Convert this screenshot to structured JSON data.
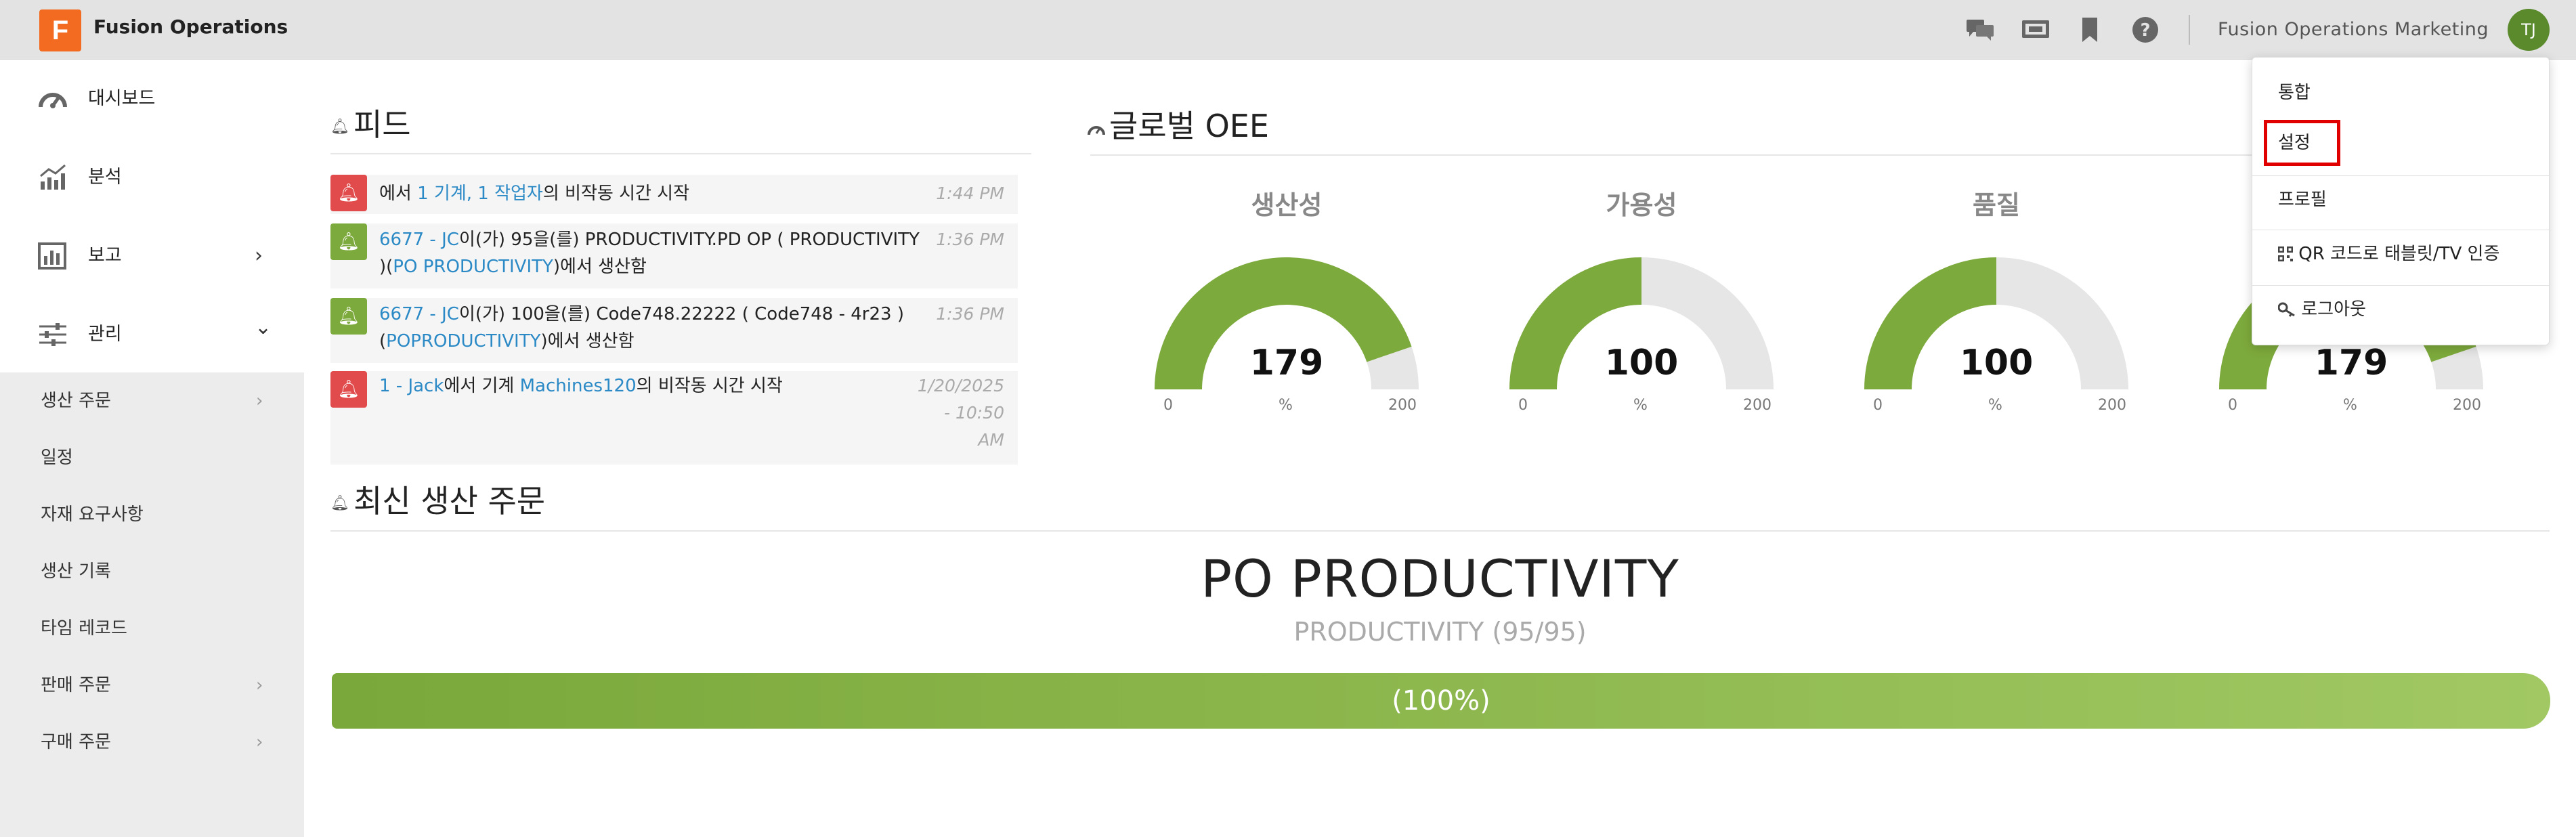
{
  "app": {
    "logo_letter": "F",
    "name": "Fusion Operations"
  },
  "header": {
    "icons": [
      "chat-icon",
      "monitor-icon",
      "bookmark-icon",
      "help-icon"
    ],
    "organization": "Fusion Operations Marketing",
    "user_initials": "TJ"
  },
  "sidebar": {
    "main_items": [
      {
        "label": "대시보드",
        "icon": "dashboard-icon"
      },
      {
        "label": "분석",
        "icon": "analytics-icon"
      },
      {
        "label": "보고",
        "icon": "report-icon",
        "chevron": "›"
      },
      {
        "label": "관리",
        "icon": "sliders-icon",
        "chevron": "⌄"
      }
    ],
    "sub_items": [
      {
        "label": "생산 주문",
        "chevron": "›"
      },
      {
        "label": "일정"
      },
      {
        "label": "자재 요구사항"
      },
      {
        "label": "생산 기록"
      },
      {
        "label": "타임 레코드"
      },
      {
        "label": "판매 주문",
        "chevron": "›"
      },
      {
        "label": "구매 주문",
        "chevron": "›"
      }
    ]
  },
  "feed": {
    "title": "피드",
    "items": [
      {
        "status": "red",
        "line1": {
          "pre": "에서 ",
          "link": "1 기계, 1 작업자",
          "post": "의 비작동 시간 시작"
        },
        "time": "1:44 PM"
      },
      {
        "status": "green",
        "line1": {
          "link": "6677 - JC",
          "post": "이(가) 95을(를) PRODUCTIVITY.PD OP ( PRODUCTIVITY"
        },
        "line2": {
          "pre": ")(",
          "link": "PO PRODUCTIVITY",
          "post": ")에서 생산함"
        },
        "time": "1:36 PM"
      },
      {
        "status": "green",
        "line1": {
          "link": "6677 - JC",
          "post": "이(가) 100을(를) Code748.22222 ( Code748 - 4r23 )"
        },
        "line2": {
          "pre": "(",
          "link": "POPRODUCTIVITY",
          "post": ")에서 생산함"
        },
        "time": "1:36 PM"
      },
      {
        "status": "red",
        "line1": {
          "link": "1 - Jack",
          "mid": "에서 기계 ",
          "link2": "Machines120",
          "post": "의 비작동 시간 시작"
        },
        "time_lines": [
          "1/20/2025",
          "- 10:50",
          "AM"
        ]
      }
    ]
  },
  "oee": {
    "title": "글로벌 OEE",
    "gauges": [
      {
        "label": "생산성",
        "value": 179,
        "display": "179",
        "min": "0",
        "max": "200",
        "unit": "%"
      },
      {
        "label": "가용성",
        "value": 100,
        "display": "100",
        "min": "0",
        "max": "200",
        "unit": "%"
      },
      {
        "label": "품질",
        "value": 100,
        "display": "100",
        "min": "0",
        "max": "200",
        "unit": "%"
      },
      {
        "label": "",
        "value": 179,
        "display": "179",
        "min": "0",
        "max": "200",
        "unit": "%"
      }
    ],
    "colors": {
      "fill": "#7daa3c",
      "track": "#e6e6e6"
    }
  },
  "latest_orders": {
    "title": "최신 생산 주문",
    "order_name": "PO PRODUCTIVITY",
    "order_detail": "PRODUCTIVITY (95/95)",
    "progress": 1.0,
    "progress_label": "(100%)"
  },
  "user_menu": {
    "items": [
      {
        "label": "통합"
      },
      {
        "label": "설정",
        "highlighted": true
      },
      {
        "label": "프로필"
      },
      {
        "label": "QR 코드로 태블릿/TV 인증",
        "icon": "qr-code-icon"
      },
      {
        "label": "로그아웃",
        "icon": "key-icon"
      }
    ]
  }
}
